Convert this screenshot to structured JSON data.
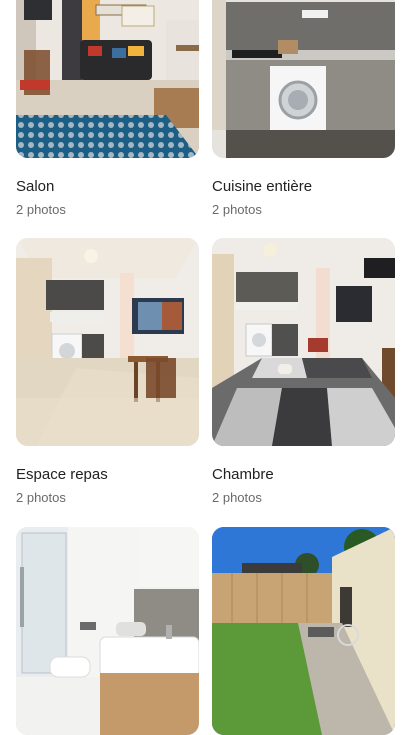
{
  "rooms": [
    {
      "title": "Salon",
      "count": "2 photos"
    },
    {
      "title": "Cuisine entière",
      "count": "2 photos"
    },
    {
      "title": "Espace repas",
      "count": "2 photos"
    },
    {
      "title": "Chambre",
      "count": "2 photos"
    },
    {
      "title": "",
      "count": ""
    },
    {
      "title": "",
      "count": ""
    }
  ]
}
